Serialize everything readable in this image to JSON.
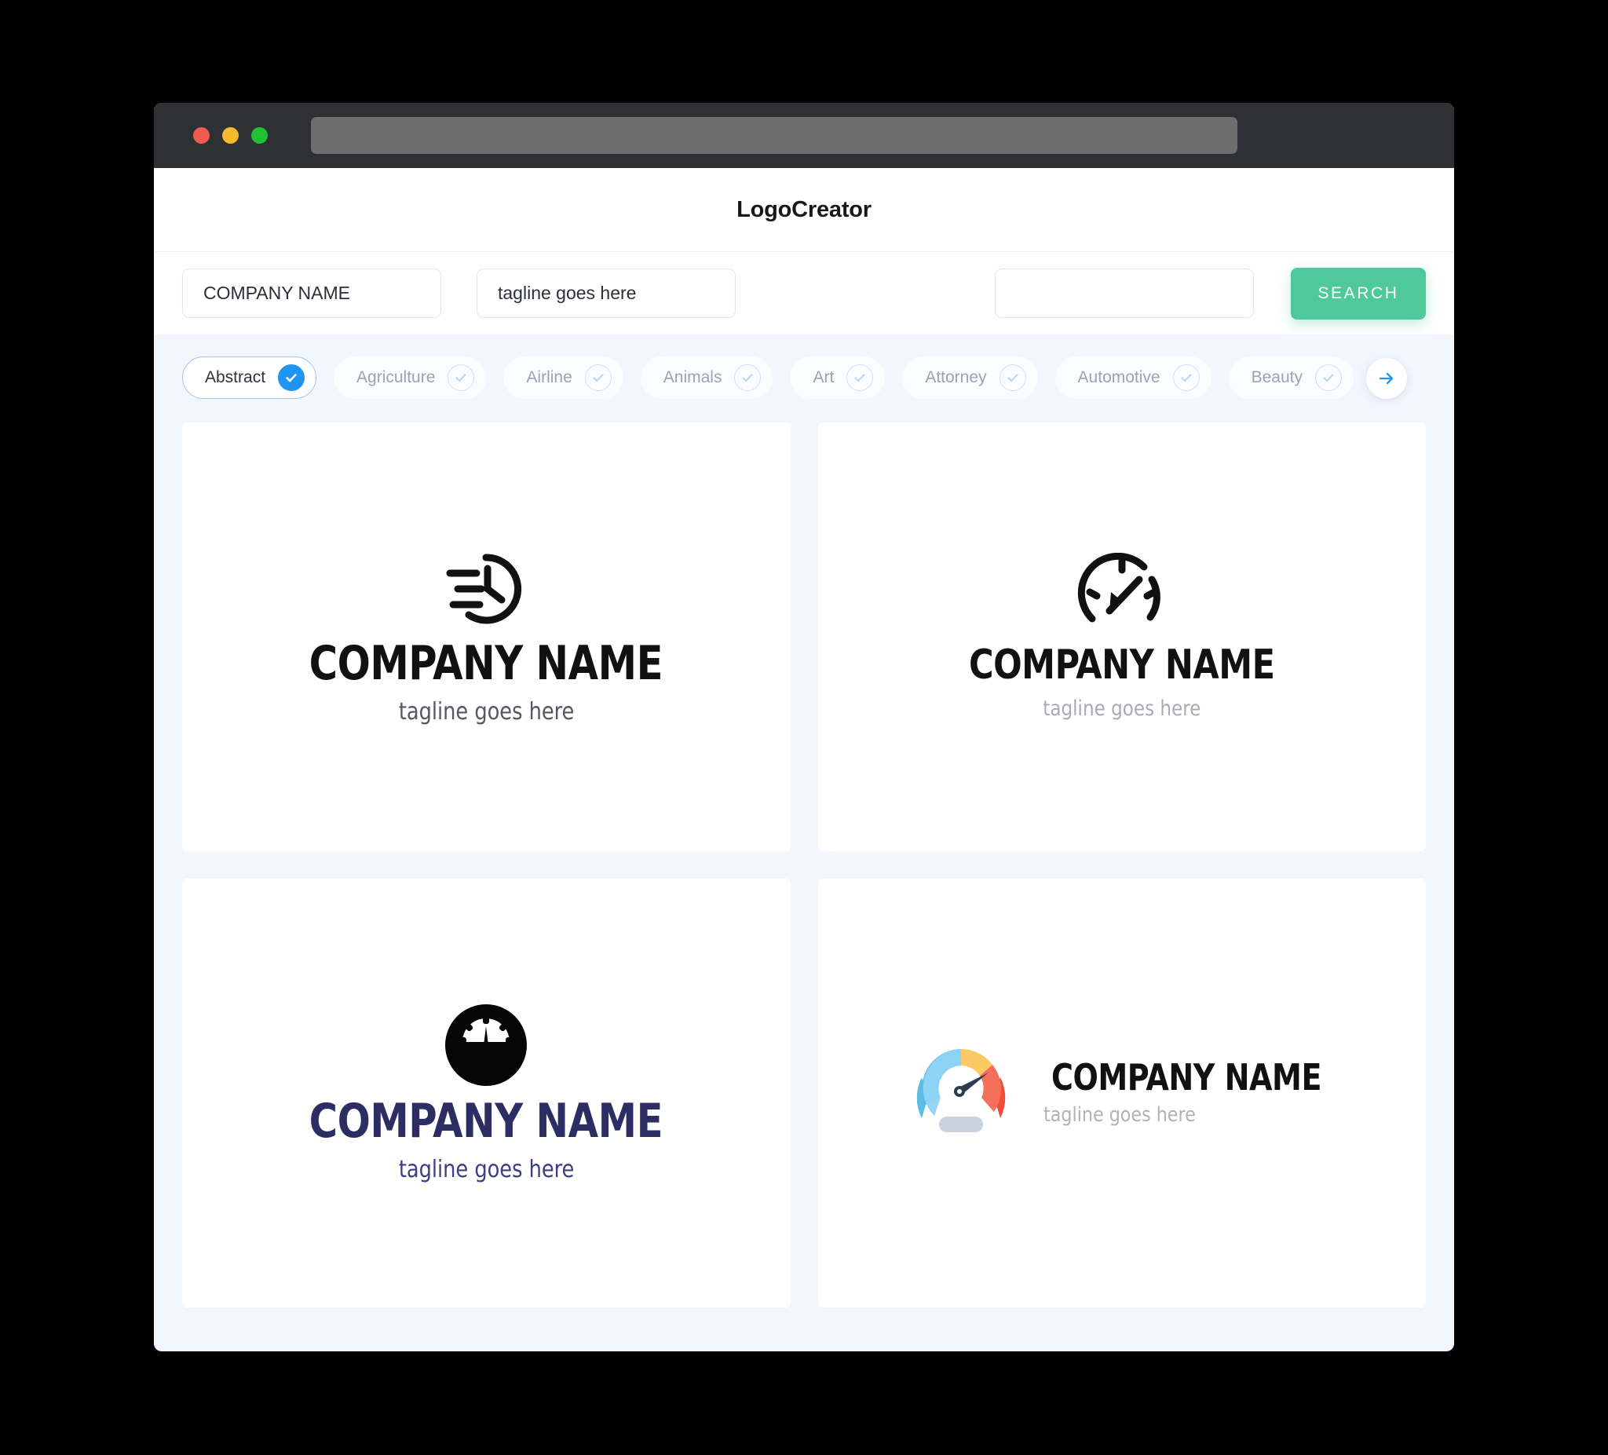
{
  "window": {
    "traffic_lights": [
      "close",
      "minimize",
      "maximize"
    ],
    "url_value": ""
  },
  "header": {
    "title": "LogoCreator"
  },
  "search": {
    "company_value": "COMPANY NAME",
    "company_placeholder": "COMPANY NAME",
    "tagline_value": "tagline goes here",
    "tagline_placeholder": "tagline goes here",
    "extra_value": "",
    "extra_placeholder": "",
    "button_label": "SEARCH",
    "button_color": "#4FC99B"
  },
  "categories": {
    "accent_color": "#2094F3",
    "next_label": "→",
    "items": [
      {
        "label": "Abstract",
        "selected": true
      },
      {
        "label": "Agriculture",
        "selected": false
      },
      {
        "label": "Airline",
        "selected": false
      },
      {
        "label": "Animals",
        "selected": false
      },
      {
        "label": "Art",
        "selected": false
      },
      {
        "label": "Attorney",
        "selected": false
      },
      {
        "label": "Automotive",
        "selected": false
      },
      {
        "label": "Beauty",
        "selected": false
      }
    ]
  },
  "results": [
    {
      "icon": "fast-clock-icon",
      "name": "COMPANY NAME",
      "tagline": "tagline goes here",
      "name_color": "#111111",
      "tagline_color": "#55585E"
    },
    {
      "icon": "speedometer-outline-icon",
      "name": "COMPANY NAME",
      "tagline": "tagline goes here",
      "name_color": "#111111",
      "tagline_color": "#A8ABB1"
    },
    {
      "icon": "gauge-circle-solid-icon",
      "name": "COMPANY NAME",
      "tagline": "tagline goes here",
      "name_color": "#2B2D63",
      "tagline_color": "#3D4080"
    },
    {
      "icon": "color-gauge-icon",
      "name": "COMPANY NAME",
      "tagline": "tagline goes here",
      "name_color": "#111111",
      "tagline_color": "#AFB2B8",
      "palette": {
        "blue": "#5BBCE4",
        "blue_light": "#8FD4F5",
        "yellow": "#F9B54C",
        "yellow_light": "#FCC965",
        "red": "#EE4F3C",
        "red_light": "#F5705A",
        "needle": "#2E3B4E",
        "base": "#C9D1DC"
      }
    }
  ]
}
